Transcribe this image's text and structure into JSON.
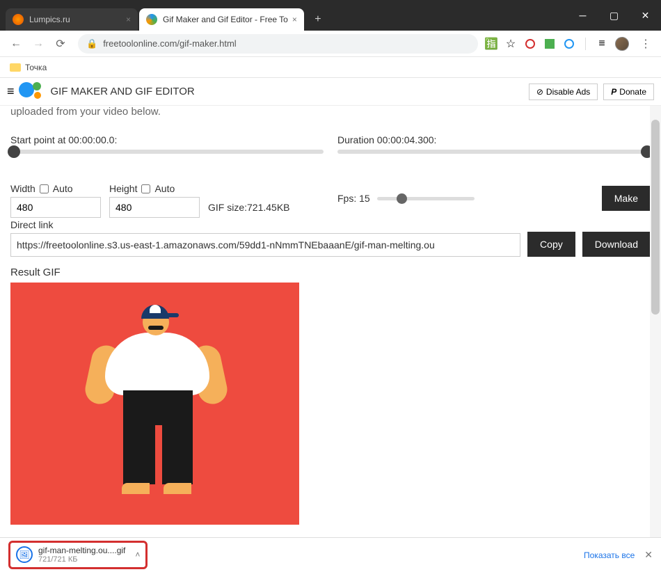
{
  "browser": {
    "tabs": [
      {
        "title": "Lumpics.ru",
        "active": false
      },
      {
        "title": "Gif Maker and Gif Editor - Free To",
        "active": true
      }
    ],
    "url": "freetoolonline.com/gif-maker.html",
    "bookmark": "Точка"
  },
  "header": {
    "title": "GIF MAKER AND GIF EDITOR",
    "disable_ads": "Disable Ads",
    "donate": "Donate"
  },
  "page": {
    "truncated": "uploaded from your video below.",
    "start_label": "Start point at 00:00:00.0:",
    "duration_label": "Duration 00:00:04.300:",
    "width_label": "Width",
    "height_label": "Height",
    "auto_label": "Auto",
    "width_value": "480",
    "height_value": "480",
    "size_label": "GIF size:721.45KB",
    "fps_label": "Fps: 15",
    "make_btn": "Make",
    "direct_link_label": "Direct link",
    "direct_link_value": "https://freetoolonline.s3.us-east-1.amazonaws.com/59dd1-nNmmTNEbaaanE/gif-man-melting.ou",
    "copy_btn": "Copy",
    "download_btn": "Download",
    "result_label": "Result GIF"
  },
  "download": {
    "filename": "gif-man-melting.ou....gif",
    "size": "721/721 КБ",
    "show_all": "Показать все"
  }
}
